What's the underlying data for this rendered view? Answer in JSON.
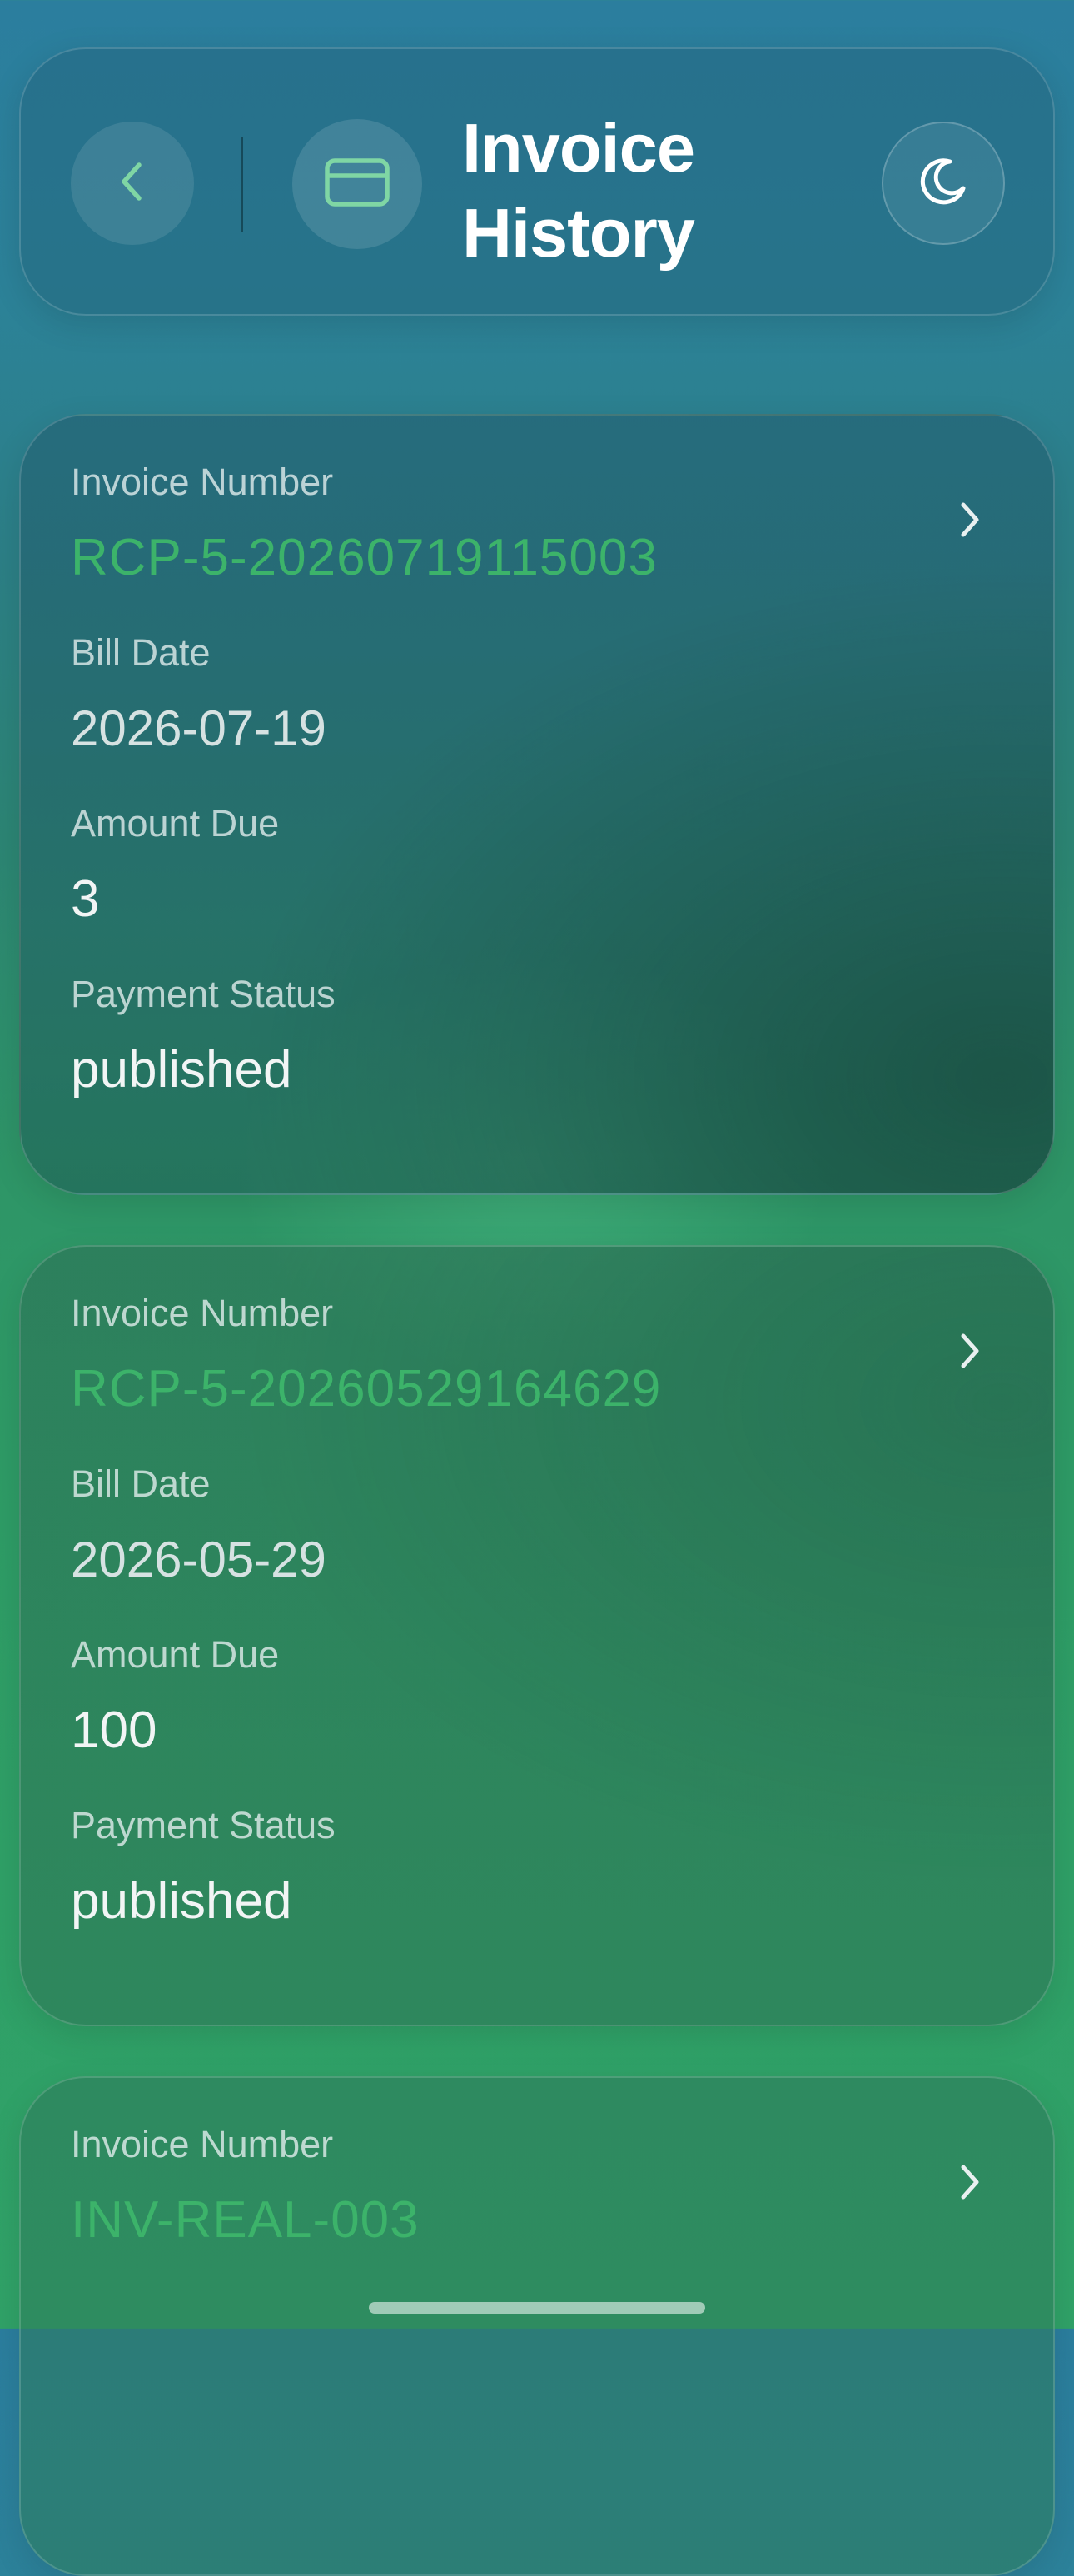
{
  "header": {
    "title": "Invoice History",
    "back_icon": "chevron-left-icon",
    "section_icon": "credit-card-icon",
    "theme_icon": "moon-icon"
  },
  "labels": {
    "invoice_number": "Invoice Number",
    "bill_date": "Bill Date",
    "amount_due": "Amount Due",
    "payment_status": "Payment Status"
  },
  "invoices": [
    {
      "number": "RCP-5-20260719115003",
      "bill_date": "2026-07-19",
      "amount_due": "3",
      "payment_status": "published"
    },
    {
      "number": "RCP-5-20260529164629",
      "bill_date": "2026-05-29",
      "amount_due": "100",
      "payment_status": "published"
    },
    {
      "number": "INV-REAL-003"
    }
  ],
  "colors": {
    "accent_green": "#3cb36a",
    "icon_green": "#7fd6a4",
    "text_white": "#ffffff"
  }
}
